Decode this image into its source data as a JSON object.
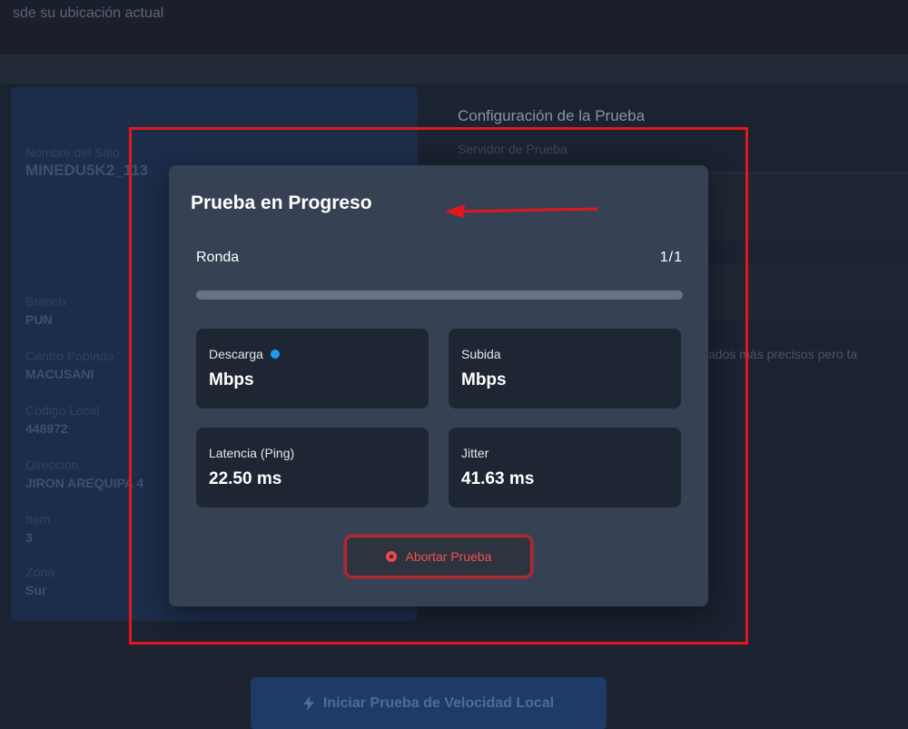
{
  "background": {
    "header_text": "sde su ubicación actual",
    "site_card": {
      "fields": [
        {
          "label": "Nombre del Sitio",
          "value": "MINEDU5K2_113"
        },
        {
          "label": "Branch",
          "value": "PUN"
        },
        {
          "label": "Centro Poblado",
          "value": "MACUSANI"
        },
        {
          "label": "Codigo Local",
          "value": "448972"
        },
        {
          "label": "Direccion",
          "value": "JIRON AREQUIPA 4"
        },
        {
          "label": "Item",
          "value": "3"
        },
        {
          "label": "Zona",
          "value": "Sur"
        }
      ]
    },
    "config": {
      "title": "Configuración de la Prueba",
      "server_label": "Servidor de Prueba",
      "note": "ados más precisos pero ta"
    },
    "start_button": {
      "icon": "lightning-icon",
      "label": "Iniciar Prueba de Velocidad Local"
    }
  },
  "modal": {
    "title": "Prueba en Progreso",
    "round_label": "Ronda",
    "round_value": "1/1",
    "progress_percent": 0,
    "metrics": {
      "download": {
        "label": "Descarga",
        "value": "Mbps",
        "status_color": "#1e9bf0"
      },
      "upload": {
        "label": "Subida",
        "value": "Mbps"
      },
      "latency": {
        "label": "Latencia (Ping)",
        "value": "22.50 ms"
      },
      "jitter": {
        "label": "Jitter",
        "value": "41.63 ms"
      }
    },
    "abort_button": {
      "label": "Abortar Prueba",
      "icon": "stop-circle-icon"
    }
  },
  "colors": {
    "annotation_red": "#e4161c",
    "modal_bg": "#364153",
    "card_bg": "#1e2633",
    "abort_red": "#f05252"
  }
}
